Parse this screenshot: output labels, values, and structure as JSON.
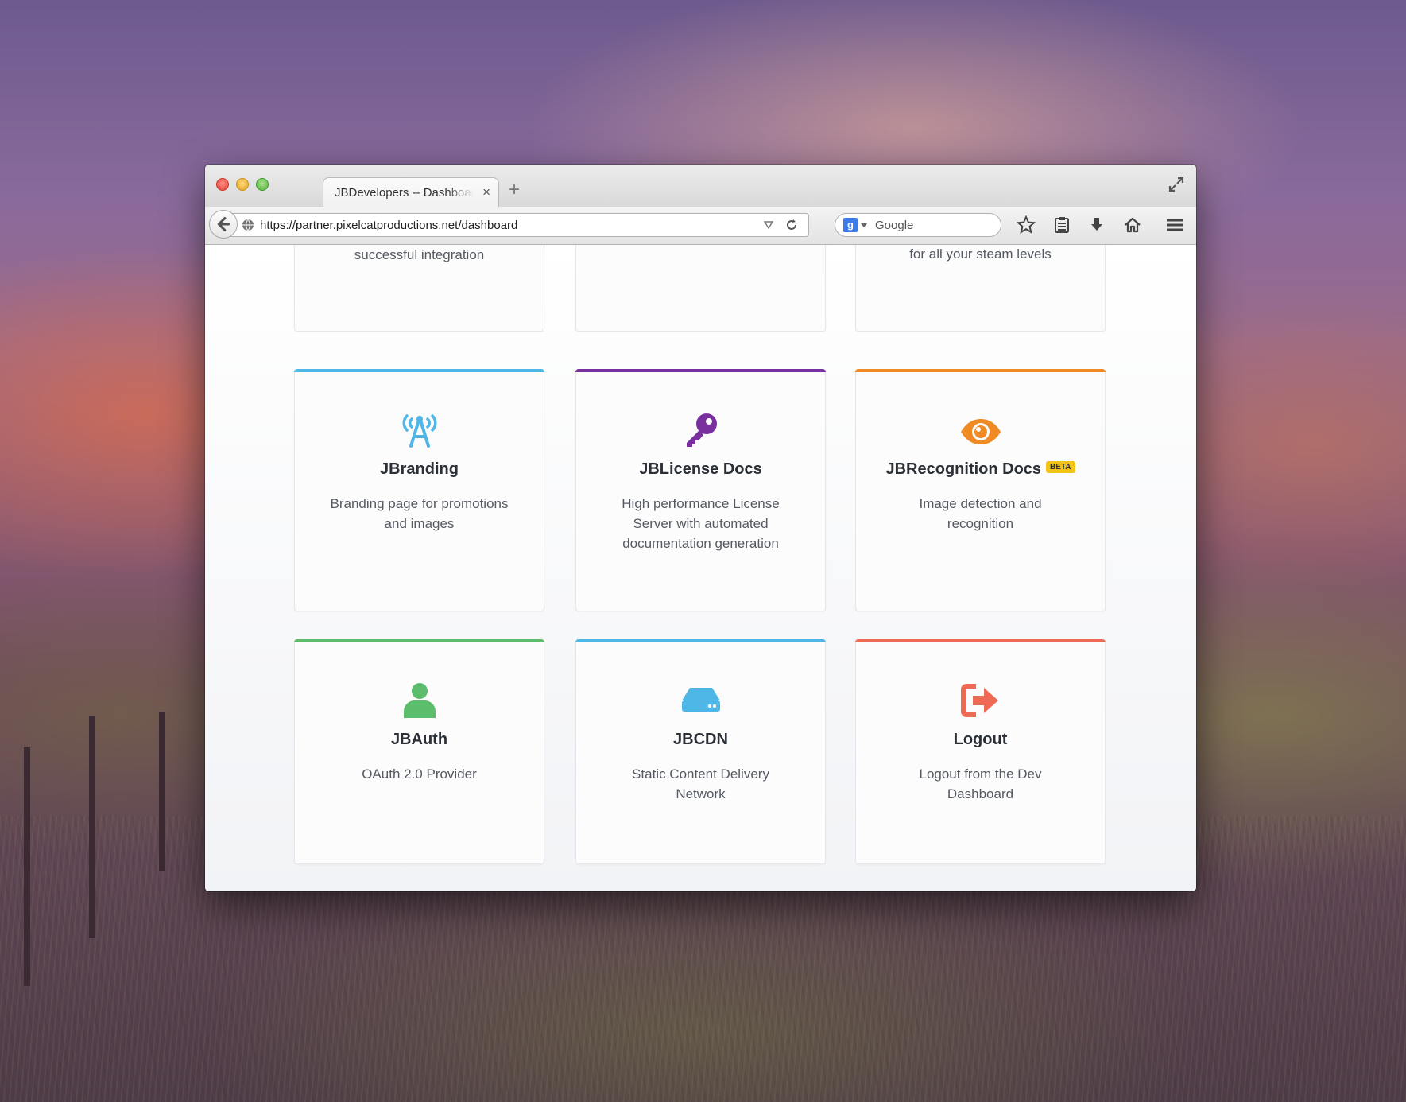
{
  "browser": {
    "tab_title": "JBDevelopers -- Dashboard",
    "tab_close": "×",
    "new_tab": "+",
    "url": "https://partner.pixelcatproductions.net/dashboard",
    "search_engine_letter": "g",
    "search_placeholder": "Google"
  },
  "cards_partial": [
    {
      "desc": "successful integration"
    },
    {
      "desc": ""
    },
    {
      "desc": "Steam badge search engine for all your steam levels"
    }
  ],
  "cards": [
    {
      "title": "JBranding",
      "desc": "Branding page for promotions and images",
      "accent": "#4fb6e8",
      "icon": "broadcast-icon"
    },
    {
      "title": "JBLicense Docs",
      "desc": "High performance License Server with automated documentation generation",
      "accent": "#7a2f9e",
      "icon": "key-icon"
    },
    {
      "title": "JBRecognition Docs",
      "badge": "BETA",
      "desc": "Image detection and recognition",
      "accent": "#f08a24",
      "icon": "eye-icon"
    },
    {
      "title": "JBAuth",
      "desc": "OAuth 2.0 Provider",
      "accent": "#5cbd6c",
      "icon": "user-icon"
    },
    {
      "title": "JBCDN",
      "desc": "Static Content Delivery Network",
      "accent": "#4fb6e8",
      "icon": "server-icon"
    },
    {
      "title": "Logout",
      "desc": "Logout from the Dev Dashboard",
      "accent": "#ef6a55",
      "icon": "logout-icon"
    }
  ]
}
